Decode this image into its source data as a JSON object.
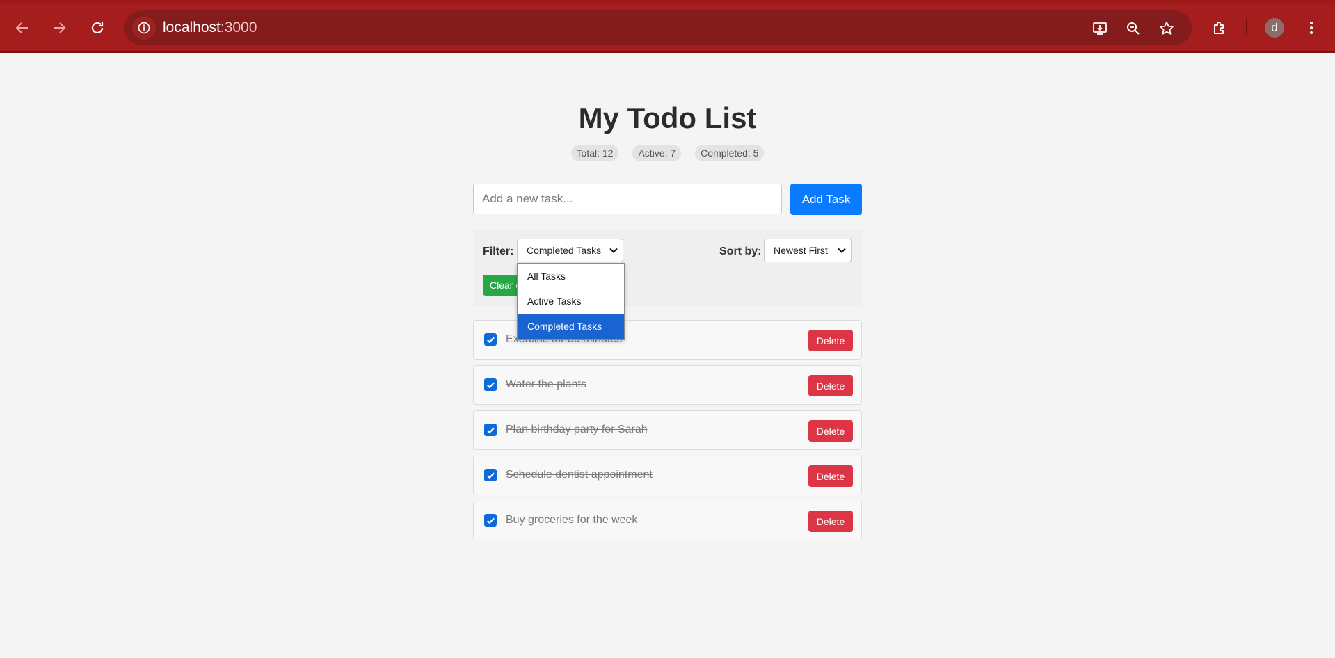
{
  "browser": {
    "url_host": "localhost",
    "url_port": ":3000",
    "profile_initial": "d",
    "icons": [
      "back-arrow-icon",
      "forward-arrow-icon",
      "reload-icon",
      "site-info-icon",
      "install-app-icon",
      "zoom-icon",
      "bookmark-star-icon",
      "extensions-icon",
      "menu-dots-icon"
    ]
  },
  "page": {
    "title": "My Todo List",
    "stats": {
      "total": "Total: 12",
      "active": "Active: 7",
      "completed": "Completed: 5"
    },
    "add": {
      "placeholder": "Add a new task...",
      "button_label": "Add Task"
    },
    "filter": {
      "label": "Filter:",
      "selected": "Completed Tasks",
      "options": [
        "All Tasks",
        "Active Tasks",
        "Completed Tasks"
      ],
      "selected_index": 2
    },
    "sort": {
      "label": "Sort by:",
      "selected": "Newest First"
    },
    "clear_button_label": "Clear c",
    "todos": [
      {
        "text": "Exercise for 30 minutes",
        "completed": true,
        "delete_label": "Delete"
      },
      {
        "text": "Water the plants",
        "completed": true,
        "delete_label": "Delete"
      },
      {
        "text": "Plan birthday party for Sarah",
        "completed": true,
        "delete_label": "Delete"
      },
      {
        "text": "Schedule dentist appointment",
        "completed": true,
        "delete_label": "Delete"
      },
      {
        "text": "Buy groceries for the week",
        "completed": true,
        "delete_label": "Delete"
      }
    ]
  },
  "colors": {
    "chrome": "#a51d1d",
    "primary": "#0a7bff",
    "danger": "#dc3545",
    "success": "#28a745",
    "dropdown_selected": "#1a64d2"
  }
}
